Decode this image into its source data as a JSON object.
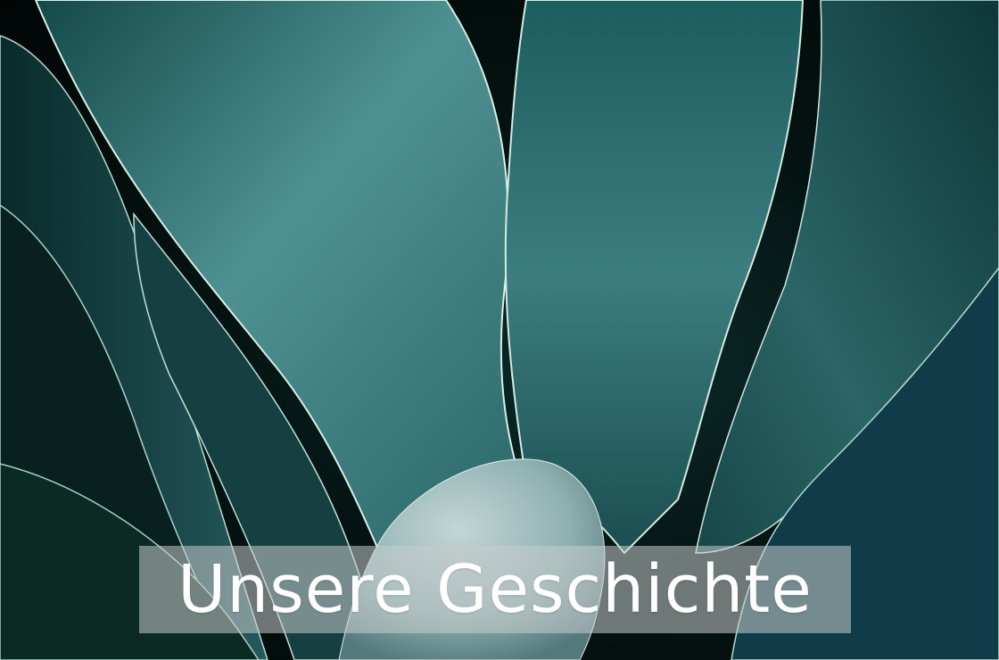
{
  "photo": {
    "subject": "agave-leaves",
    "colors": {
      "background": "#020807",
      "leaf_dark": "#0d3a3b",
      "leaf_mid": "#2f6e70",
      "leaf_light": "#6aa3a3",
      "rim": "#cfe8de",
      "core": "#a9c3c4"
    }
  },
  "banner": {
    "title": "Unsere Geschichte"
  }
}
